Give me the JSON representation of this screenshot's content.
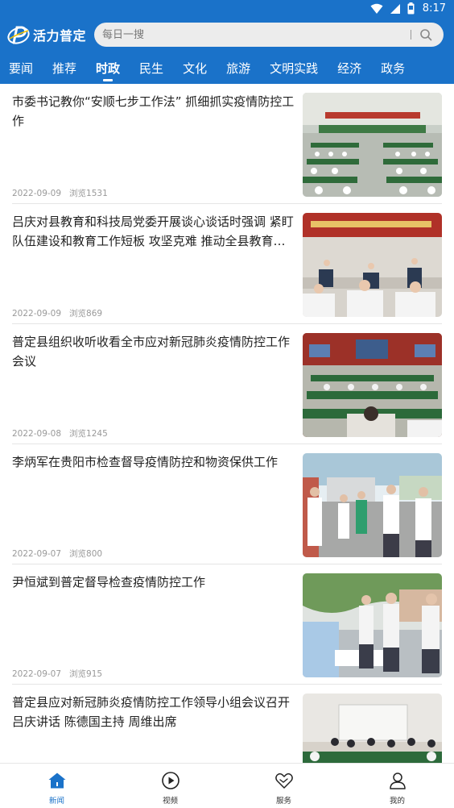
{
  "status_bar": {
    "time": "8:17",
    "icons": [
      "wifi-icon",
      "signal-icon",
      "battery-icon"
    ]
  },
  "app": {
    "name": "活力普定",
    "brand_color": "#1a72c9"
  },
  "search": {
    "placeholder": "每日一搜"
  },
  "tabs": [
    {
      "label": "要闻",
      "active": false
    },
    {
      "label": "推荐",
      "active": false
    },
    {
      "label": "时政",
      "active": true
    },
    {
      "label": "民生",
      "active": false
    },
    {
      "label": "文化",
      "active": false
    },
    {
      "label": "旅游",
      "active": false
    },
    {
      "label": "文明实践",
      "active": false
    },
    {
      "label": "经济",
      "active": false
    },
    {
      "label": "政务",
      "active": false
    }
  ],
  "news": [
    {
      "title": "市委书记教你“安顺七步工作法” 抓细抓实疫情防控工作",
      "date": "2022-09-09",
      "views": "浏览1531",
      "image": "meeting-hall-photo"
    },
    {
      "title": "吕庆对县教育和科技局党委开展谈心谈话时强调 紧盯队伍建设和教育工作短板 攻坚克难 推动全县教育高…",
      "date": "2022-09-09",
      "views": "浏览869",
      "image": "meeting-room-photo"
    },
    {
      "title": "普定县组织收听收看全市应对新冠肺炎疫情防控工作会议",
      "date": "2022-09-08",
      "views": "浏览1245",
      "image": "video-conference-photo"
    },
    {
      "title": "李炳军在贵阳市检查督导疫情防控和物资保供工作",
      "date": "2022-09-07",
      "views": "浏览800",
      "image": "inspection-outdoor-photo"
    },
    {
      "title": "尹恒斌到普定督导检查疫情防控工作",
      "date": "2022-09-07",
      "views": "浏览915",
      "image": "testing-site-photo"
    },
    {
      "title": "普定县应对新冠肺炎疫情防控工作领导小组会议召开 吕庆讲话 陈德国主持 周维出席",
      "date": "",
      "views": "",
      "image": "conference-room-photo"
    }
  ],
  "bottom_nav": [
    {
      "label": "新闻",
      "icon": "home-icon",
      "active": true
    },
    {
      "label": "视频",
      "icon": "play-circle-icon",
      "active": false
    },
    {
      "label": "服务",
      "icon": "heart-service-icon",
      "active": false
    },
    {
      "label": "我的",
      "icon": "user-icon",
      "active": false
    }
  ]
}
